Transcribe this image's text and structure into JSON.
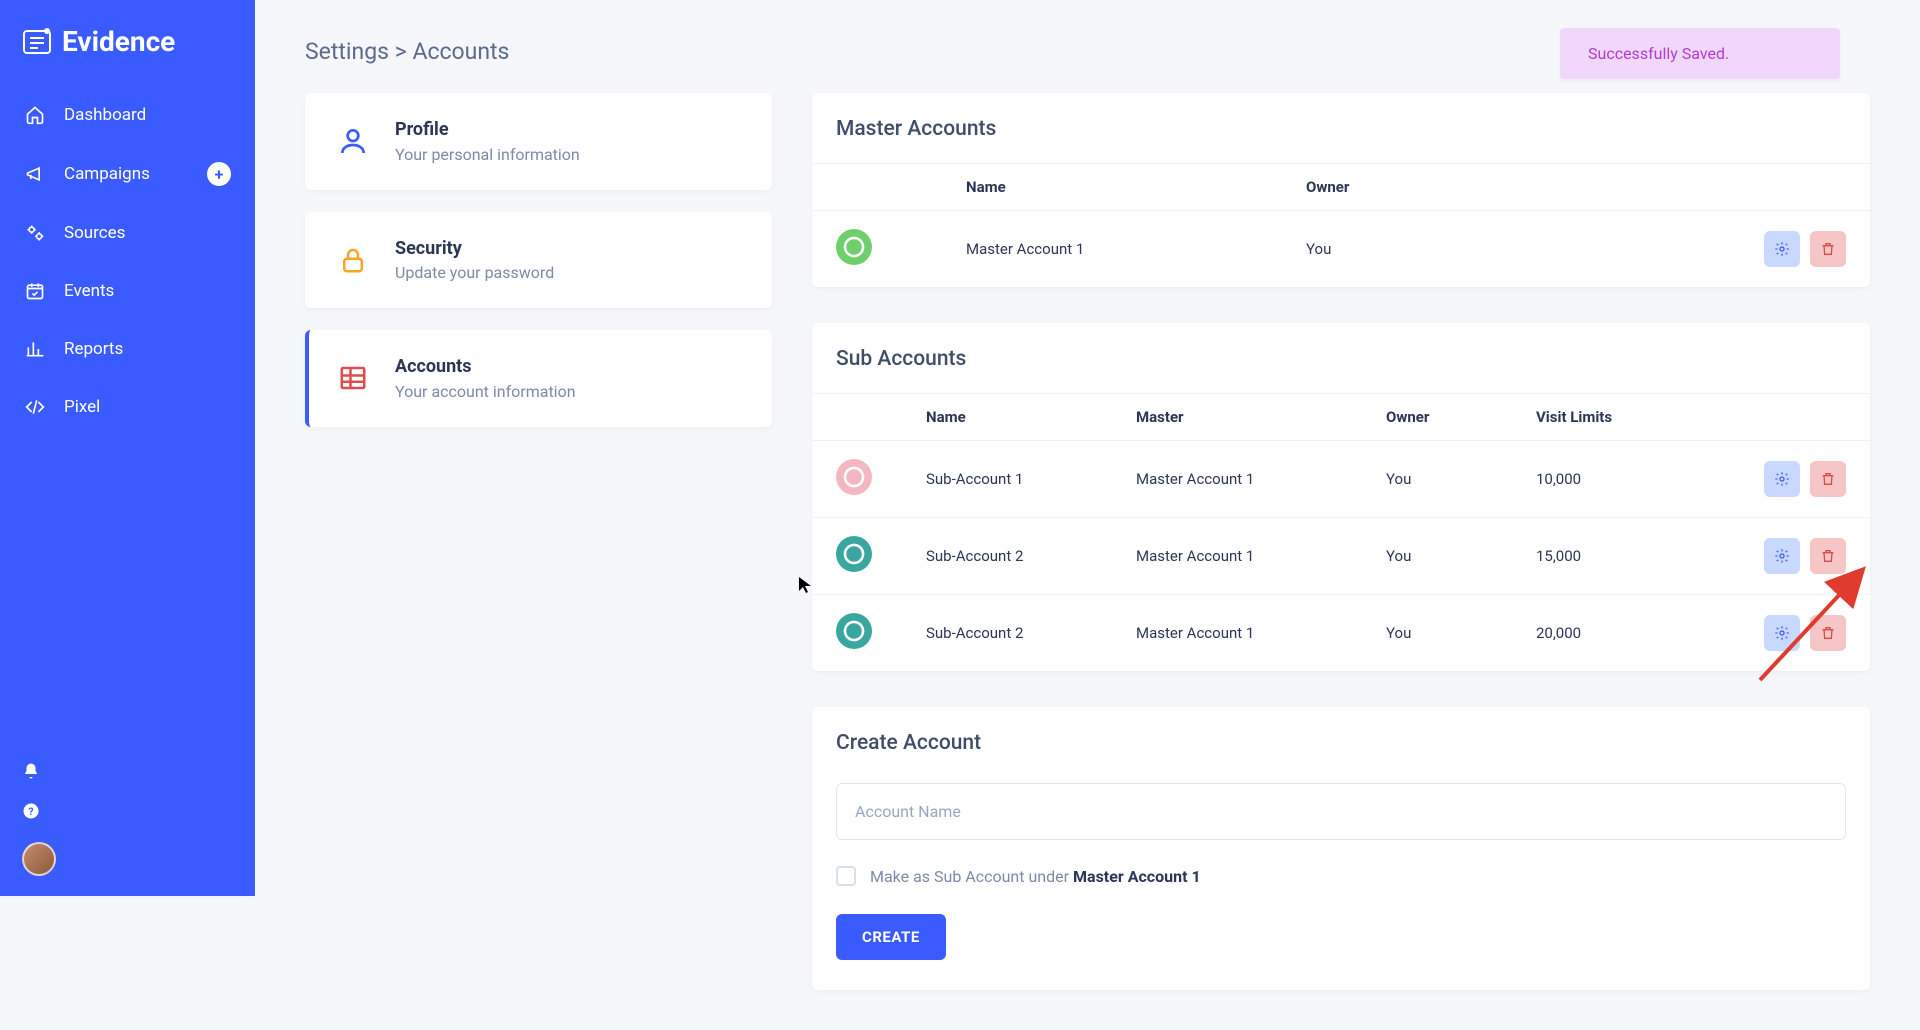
{
  "brand": "Evidence",
  "sidebar": {
    "items": [
      {
        "label": "Dashboard"
      },
      {
        "label": "Campaigns",
        "plus": true
      },
      {
        "label": "Sources"
      },
      {
        "label": "Events"
      },
      {
        "label": "Reports"
      },
      {
        "label": "Pixel"
      }
    ]
  },
  "breadcrumb": {
    "parent": "Settings",
    "sep": ">",
    "current": "Accounts"
  },
  "settings_tabs": {
    "profile": {
      "title": "Profile",
      "sub": "Your personal information"
    },
    "security": {
      "title": "Security",
      "sub": "Update your password"
    },
    "accounts": {
      "title": "Accounts",
      "sub": "Your account information"
    }
  },
  "toast": {
    "text": "Successfully Saved."
  },
  "master_panel": {
    "title": "Master Accounts",
    "columns": {
      "name": "Name",
      "owner": "Owner"
    },
    "rows": [
      {
        "name": "Master Account 1",
        "owner": "You"
      }
    ]
  },
  "sub_panel": {
    "title": "Sub Accounts",
    "columns": {
      "name": "Name",
      "master": "Master",
      "owner": "Owner",
      "limits": "Visit Limits"
    },
    "rows": [
      {
        "name": "Sub-Account 1",
        "master": "Master Account 1",
        "owner": "You",
        "limits": "10,000"
      },
      {
        "name": "Sub-Account 2",
        "master": "Master Account 1",
        "owner": "You",
        "limits": "15,000"
      },
      {
        "name": "Sub-Account 2",
        "master": "Master Account 1",
        "owner": "You",
        "limits": "20,000"
      }
    ]
  },
  "create_panel": {
    "title": "Create Account",
    "placeholder": "Account Name",
    "checkbox_prefix": "Make as Sub Account under ",
    "checkbox_bold": "Master Account 1",
    "button": "CREATE"
  }
}
